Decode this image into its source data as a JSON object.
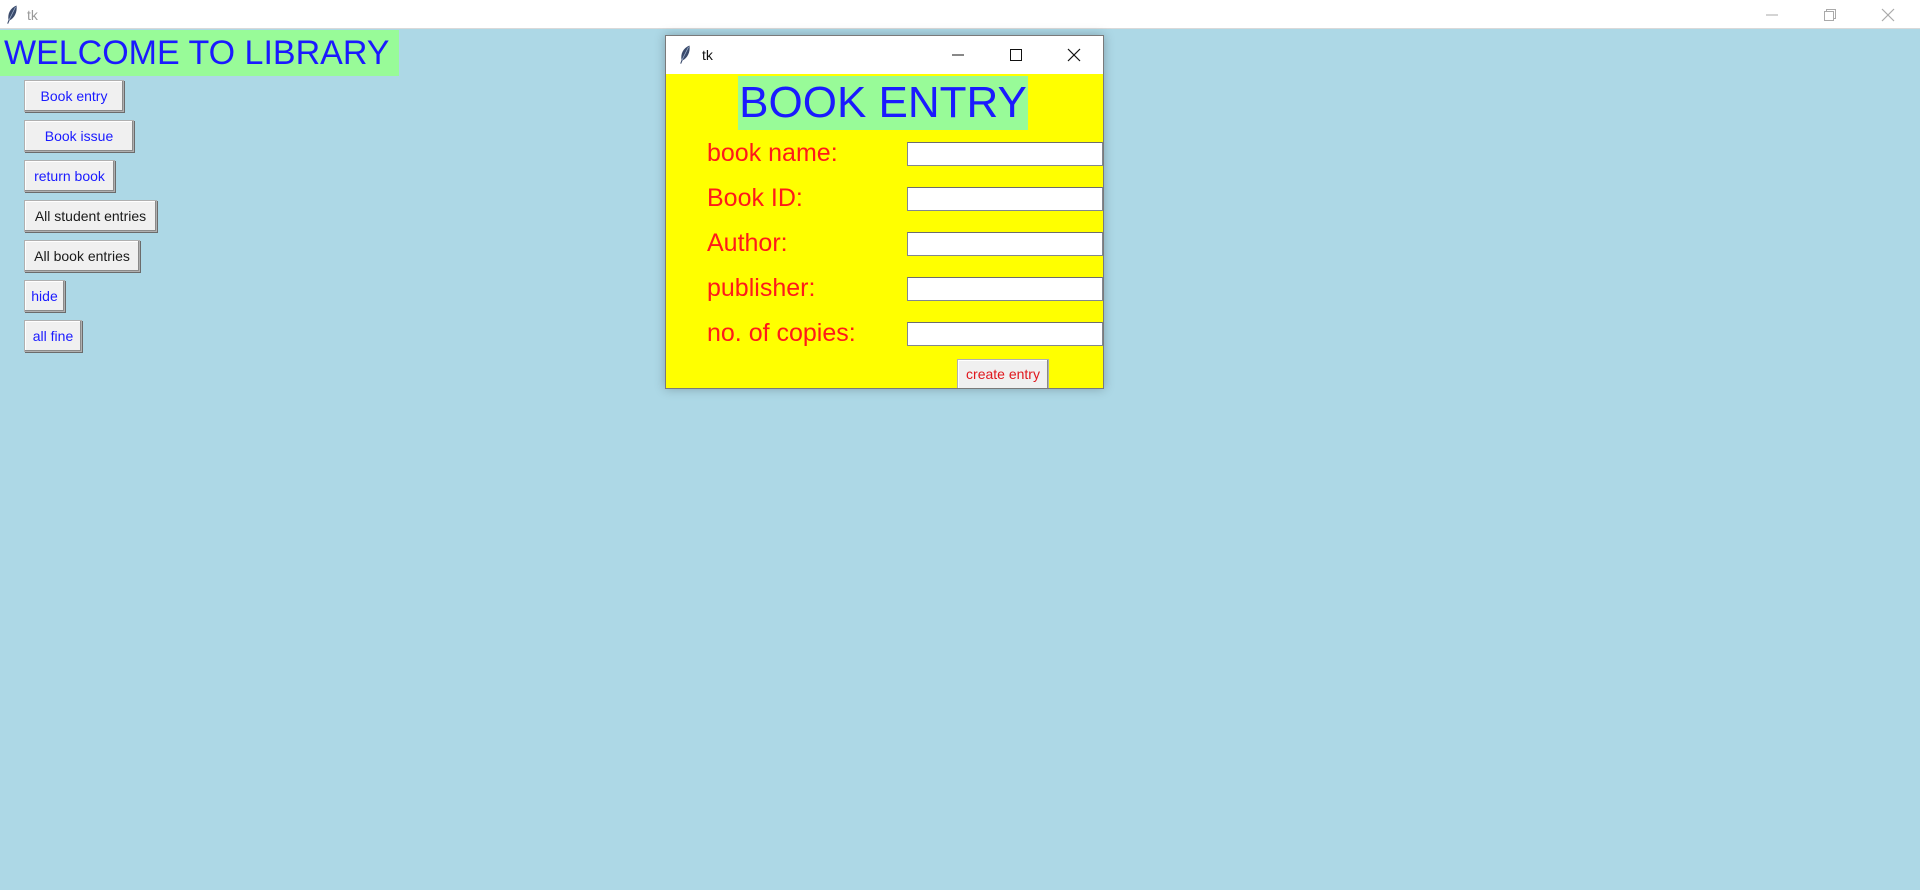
{
  "window": {
    "title": "tk",
    "controls": [
      "minimize",
      "restore",
      "close"
    ]
  },
  "main": {
    "heading": "WELCOME TO LIBRARY",
    "buttons": [
      {
        "label": "Book entry",
        "color": "#1a1aff"
      },
      {
        "label": "Book issue",
        "color": "#1a1aff"
      },
      {
        "label": "return book",
        "color": "#1a1aff"
      },
      {
        "label": "All student entries",
        "color": "#1a1a1a"
      },
      {
        "label": "All book entries",
        "color": "#1a1a1a"
      },
      {
        "label": "hide",
        "color": "#1a1aff"
      },
      {
        "label": "all fine",
        "color": "#1a1aff"
      }
    ]
  },
  "dialog": {
    "title": "tk",
    "heading": "BOOK ENTRY",
    "fields": [
      {
        "label": "book name:",
        "value": ""
      },
      {
        "label": "Book ID:",
        "value": ""
      },
      {
        "label": "Author:",
        "value": ""
      },
      {
        "label": "publisher:",
        "value": ""
      },
      {
        "label": "no. of copies:",
        "value": ""
      }
    ],
    "submit_label": "create entry"
  },
  "colors": {
    "background": "#add8e6",
    "heading_bg": "#98fb98",
    "heading_text": "#1a1aff",
    "dialog_bg": "#ffff00",
    "label_text": "#ff1a1a"
  },
  "icons": [
    "feather-icon",
    "minimize-icon",
    "restore-icon",
    "maximize-icon",
    "close-icon"
  ]
}
